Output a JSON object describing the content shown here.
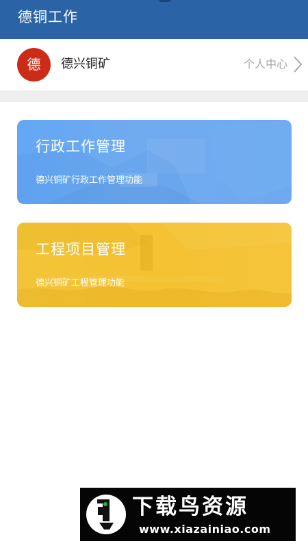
{
  "app_bar": {
    "title": "德铜工作"
  },
  "user": {
    "avatar_text": "德",
    "name": "德兴铜矿",
    "profile_link_label": "个人中心",
    "chevron_icon": "chevron-right-icon"
  },
  "cards": [
    {
      "title": "行政工作管理",
      "subtitle": "德兴铜矿行政工作管理功能",
      "color": "#65a7f2"
    },
    {
      "title": "工程项目管理",
      "subtitle": "德兴铜矿工程管理功能",
      "color": "#f4c433"
    }
  ],
  "watermark": {
    "title": "下载鸟资源",
    "url": "www.xiazainiao.com"
  },
  "colors": {
    "app_bar": "#2a64a7",
    "avatar": "#cc2c17",
    "divider": "#eeeeee"
  }
}
